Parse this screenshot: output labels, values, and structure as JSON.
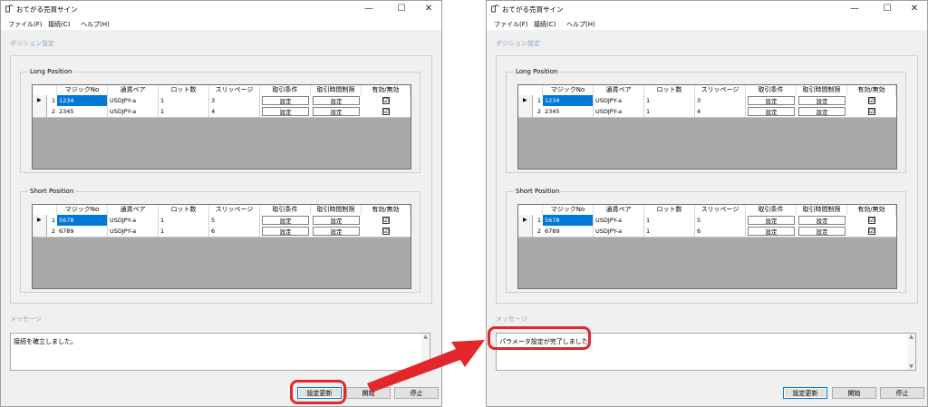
{
  "windows": [
    {
      "title": "おてがる売買サイン",
      "menu": [
        "ファイル(F)",
        "接続(C)",
        "ヘルプ(H)"
      ],
      "section_position": "ポジション設定",
      "long_label": "Long Position",
      "short_label": "Short Position",
      "headers": [
        "マジックNo",
        "通貨ペア",
        "ロット数",
        "スリッページ",
        "取引条件",
        "取引時間制限",
        "有効/無効"
      ],
      "long_rows": [
        {
          "num": "1",
          "magic": "1234",
          "pair": "USDJPY-a",
          "lot": "1",
          "slip": "3",
          "cond": "設定",
          "time": "設定",
          "enabled": "☑"
        },
        {
          "num": "2",
          "magic": "2345",
          "pair": "USDJPY-a",
          "lot": "1",
          "slip": "4",
          "cond": "設定",
          "time": "設定",
          "enabled": "☑"
        }
      ],
      "short_rows": [
        {
          "num": "1",
          "magic": "5678",
          "pair": "USDJPY-a",
          "lot": "1",
          "slip": "5",
          "cond": "設定",
          "time": "設定",
          "enabled": "☑"
        },
        {
          "num": "2",
          "magic": "6789",
          "pair": "USDJPY-a",
          "lot": "1",
          "slip": "6",
          "cond": "設定",
          "time": "設定",
          "enabled": "☑"
        }
      ],
      "message_label": "メッセージ",
      "message": "接続を確立しました。",
      "buttons": {
        "update": "設定更新",
        "start": "開始",
        "stop": "停止"
      }
    },
    {
      "title": "おてがる売買サイン",
      "menu": [
        "ファイル(F)",
        "接続(C)",
        "ヘルプ(H)"
      ],
      "section_position": "ポジション設定",
      "long_label": "Long Position",
      "short_label": "Short Position",
      "headers": [
        "マジックNo",
        "通貨ペア",
        "ロット数",
        "スリッページ",
        "取引条件",
        "取引時間制限",
        "有効/無効"
      ],
      "long_rows": [
        {
          "num": "1",
          "magic": "1234",
          "pair": "USDJPY-a",
          "lot": "1",
          "slip": "3",
          "cond": "設定",
          "time": "設定",
          "enabled": "☑"
        },
        {
          "num": "2",
          "magic": "2345",
          "pair": "USDJPY-a",
          "lot": "1",
          "slip": "4",
          "cond": "設定",
          "time": "設定",
          "enabled": "☑"
        }
      ],
      "short_rows": [
        {
          "num": "1",
          "magic": "5678",
          "pair": "USDJPY-a",
          "lot": "1",
          "slip": "5",
          "cond": "設定",
          "time": "設定",
          "enabled": "☑"
        },
        {
          "num": "2",
          "magic": "6789",
          "pair": "USDJPY-a",
          "lot": "1",
          "slip": "6",
          "cond": "設定",
          "time": "設定",
          "enabled": "☑"
        }
      ],
      "message_label": "メッセージ",
      "message": "パラメータ設定が完了しました。",
      "buttons": {
        "update": "設定更新",
        "start": "開始",
        "stop": "停止"
      }
    }
  ],
  "window_controls": {
    "minimize": "—",
    "maximize": "☐",
    "close": "✕"
  },
  "icons": {
    "app": "app-icon",
    "row_pointer": "▶",
    "scroll_up": "▲",
    "scroll_down": "▼"
  },
  "colors": {
    "highlight": "#e3262a",
    "selection": "#0078d7",
    "grid_bg": "#a9a9a9"
  }
}
